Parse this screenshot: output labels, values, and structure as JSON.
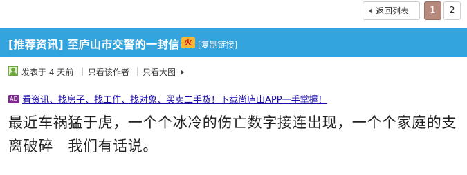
{
  "pager": {
    "back_label": "返回列表",
    "pages": [
      "1",
      "2"
    ],
    "current_page": "1"
  },
  "thread": {
    "title": "[推荐资讯] 至庐山市交警的一封信",
    "hot_icon_text": "火",
    "copy_link_label": "[复制链接]"
  },
  "meta": {
    "posted": "发表于 4 天前",
    "sep": "|",
    "author_only": "只看该作者",
    "image_only": "只看大图"
  },
  "ad": {
    "badge": "AD",
    "text": "看资讯、找房子、找工作、找对象、买卖二手货！下载尚庐山APP一手掌握！"
  },
  "post": {
    "body": "最近车祸猛于虎，一个个冰冷的伤亡数字接连出现，一个个家庭的支离破碎　我们有话说。"
  },
  "colors": {
    "title_bar": "#33a4dd",
    "active_page": "#b58a7d",
    "ad_link": "#1a0dab"
  }
}
